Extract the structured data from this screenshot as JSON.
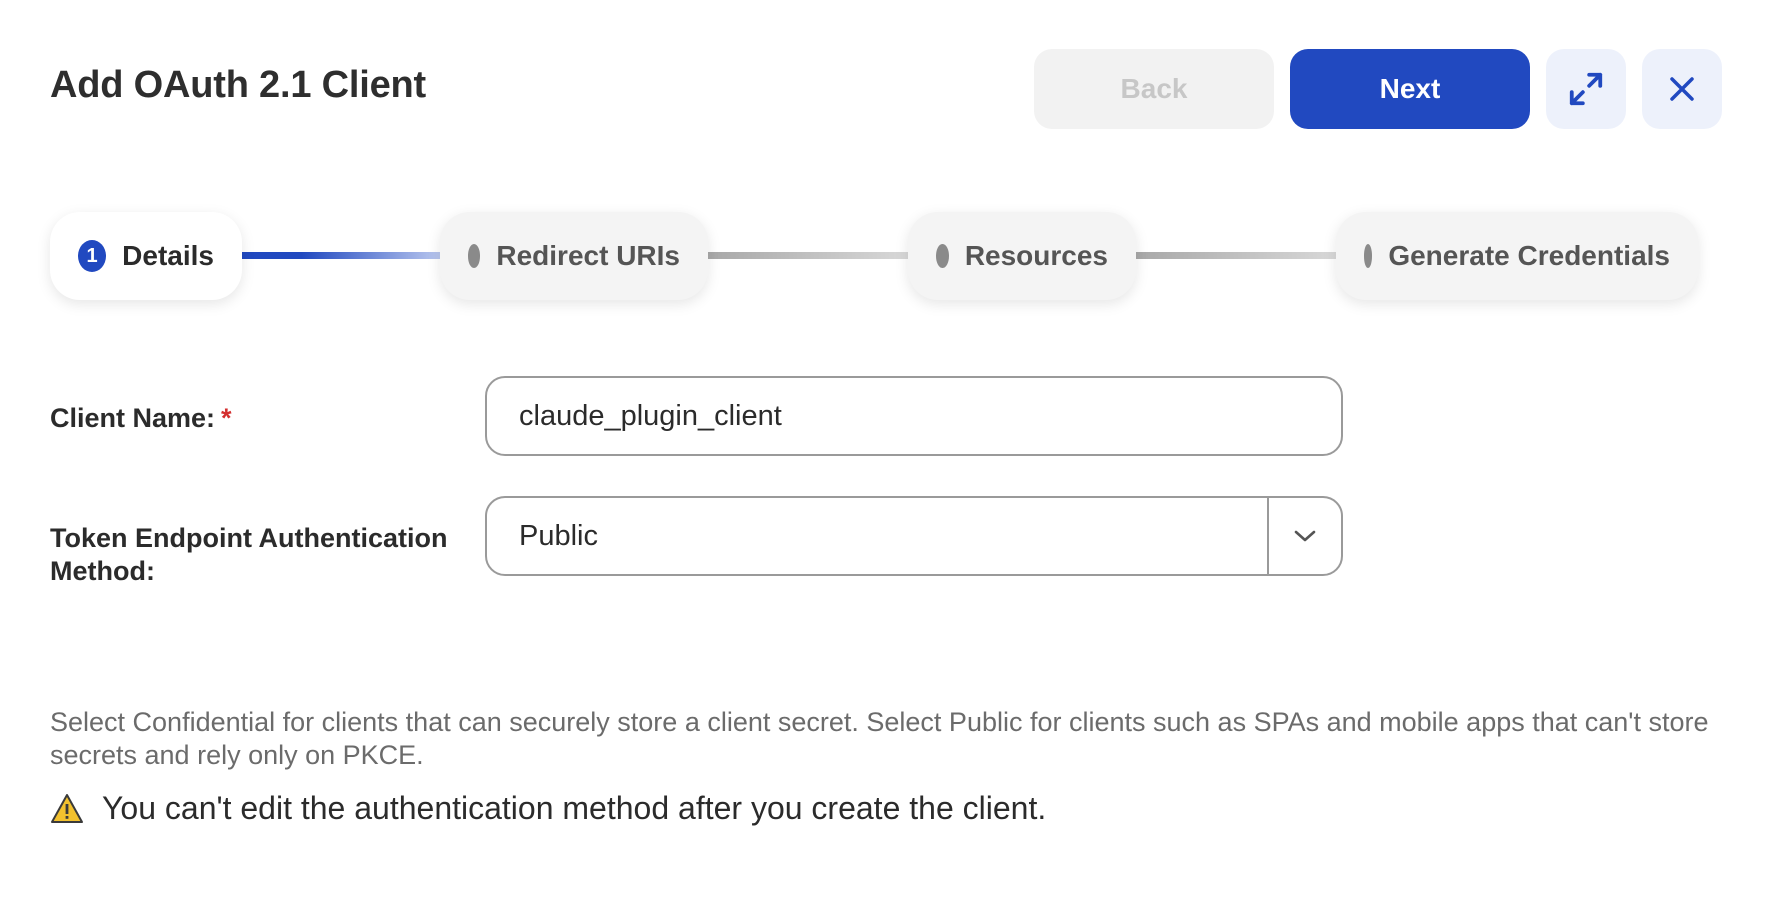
{
  "header": {
    "title": "Add OAuth 2.1 Client",
    "back_label": "Back",
    "next_label": "Next",
    "expand_icon": "expand-icon",
    "close_icon": "close-icon"
  },
  "stepper": {
    "steps": [
      {
        "number": "1",
        "label": "Details",
        "state": "active"
      },
      {
        "label": "Redirect URIs",
        "state": "pending"
      },
      {
        "label": "Resources",
        "state": "pending"
      },
      {
        "label": "Generate Credentials",
        "state": "pending"
      }
    ]
  },
  "form": {
    "client_name_label": "Client Name:",
    "required_mark": "*",
    "client_name_value": "claude_plugin_client",
    "auth_method_label": "Token Endpoint Authentication Method:",
    "auth_method_value": "Public"
  },
  "help_text": "Select Confidential for clients that can securely store a client secret. Select Public for clients such as SPAs and mobile apps that can't store secrets and rely only on PKCE.",
  "warning_text": "You can't edit the authentication method after you create the client.",
  "colors": {
    "primary": "#2149c0",
    "warning": "#f2c12e",
    "required": "#d32f2f"
  }
}
